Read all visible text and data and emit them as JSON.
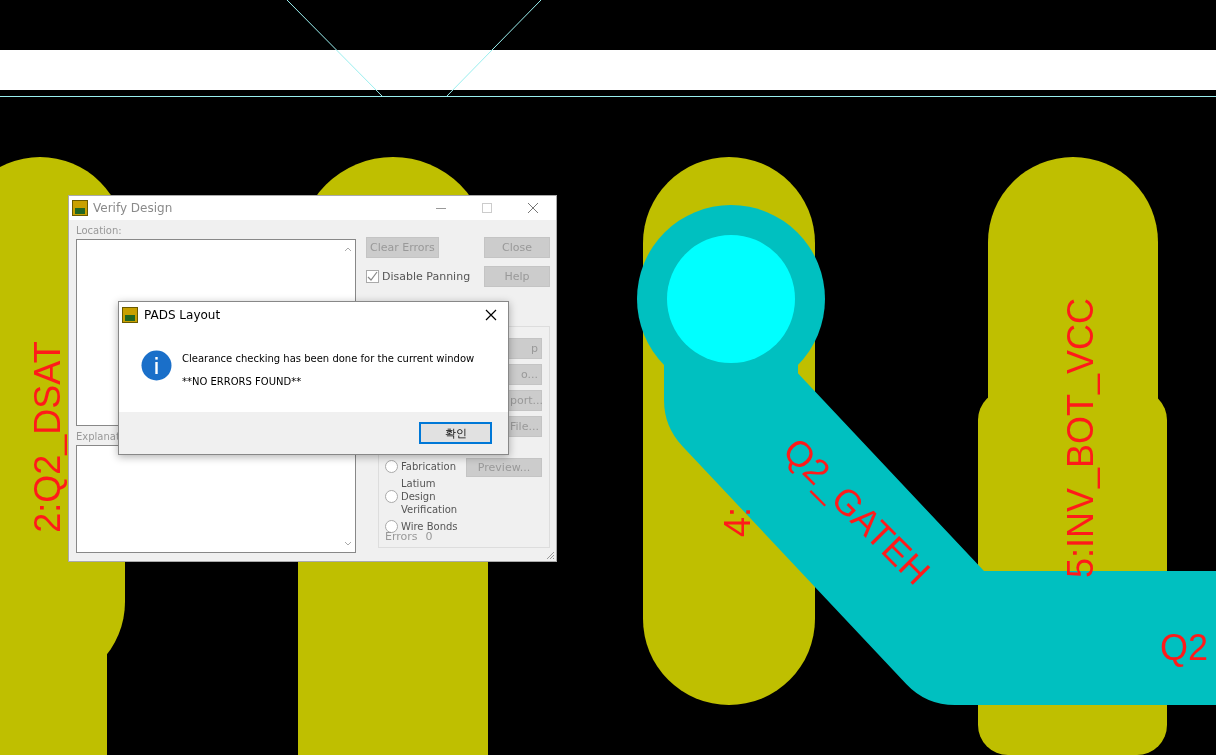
{
  "pcb": {
    "labels": [
      {
        "text": "2:Q2_DSAT"
      },
      {
        "text": "4:"
      },
      {
        "text": "Q2_GATEH"
      },
      {
        "text": "5:INV_BOT_VCC"
      },
      {
        "text": "Q2"
      }
    ]
  },
  "verify_window": {
    "title": "Verify Design",
    "location_label": "Location:",
    "explanation_label": "Explanat",
    "buttons": [
      {
        "label": "Clear Errors"
      },
      {
        "label": "Close"
      },
      {
        "label": "Help"
      }
    ],
    "disable_panning": {
      "label": "Disable Panning",
      "checked": true
    },
    "partial_buttons": [
      "p",
      "o...",
      "port...",
      "File...",
      "Preview..."
    ],
    "options": [
      {
        "label": "Fabrication",
        "selected": false
      },
      {
        "label": "Latium Design Verification",
        "selected": false
      },
      {
        "label": "Wire Bonds",
        "selected": false
      }
    ],
    "errors_label": "Errors",
    "errors_count": "0"
  },
  "message_box": {
    "title": "PADS Layout",
    "message": "Clearance checking has been done for the current window",
    "detail": "**NO ERRORS FOUND**",
    "ok_button": "확인"
  }
}
